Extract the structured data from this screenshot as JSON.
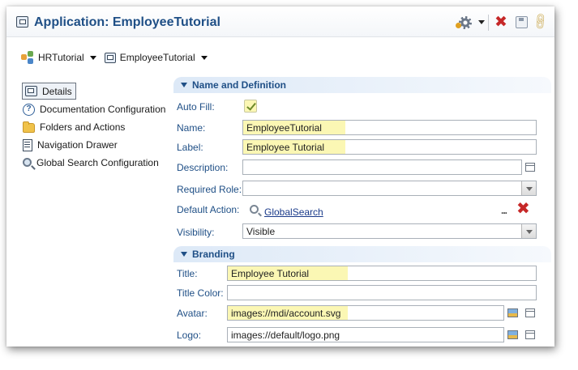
{
  "header": {
    "title": "Application: EmployeeTutorial",
    "icons": [
      "application-icon",
      "gear-icon",
      "chevron-down-icon",
      "delete-icon",
      "save-icon",
      "link-icon"
    ]
  },
  "breadcrumb": [
    {
      "label": "HRTutorial",
      "icon": "module-icon"
    },
    {
      "label": "EmployeeTutorial",
      "icon": "application-icon"
    }
  ],
  "nav": {
    "items": [
      {
        "label": "Details",
        "icon": "details-icon",
        "selected": true
      },
      {
        "label": "Documentation Configuration",
        "icon": "help-icon"
      },
      {
        "label": "Folders and Actions",
        "icon": "folder-icon"
      },
      {
        "label": "Navigation Drawer",
        "icon": "drawer-icon"
      },
      {
        "label": "Global Search Configuration",
        "icon": "search-icon"
      }
    ]
  },
  "sections": {
    "definition": {
      "title": "Name and Definition",
      "auto_fill": {
        "label": "Auto Fill:",
        "checked": true
      },
      "name": {
        "label": "Name:",
        "value": "EmployeeTutorial"
      },
      "label": {
        "label": "Label:",
        "value": "Employee Tutorial"
      },
      "description": {
        "label": "Description:",
        "value": ""
      },
      "required_role": {
        "label": "Required Role:",
        "value": ""
      },
      "default_action": {
        "label": "Default Action:",
        "value": "GlobalSearch",
        "more": "..."
      },
      "visibility": {
        "label": "Visibility:",
        "value": "Visible"
      }
    },
    "branding": {
      "title": "Branding",
      "title_field": {
        "label": "Title:",
        "value": "Employee Tutorial"
      },
      "title_color": {
        "label": "Title Color:",
        "value": ""
      },
      "avatar": {
        "label": "Avatar:",
        "value": "images://mdi/account.svg"
      },
      "logo": {
        "label": "Logo:",
        "value": "images://default/logo.png"
      }
    }
  },
  "colors": {
    "accent": "#1f4f86",
    "highlight": "#fbf7b4",
    "delete": "#c62828"
  }
}
